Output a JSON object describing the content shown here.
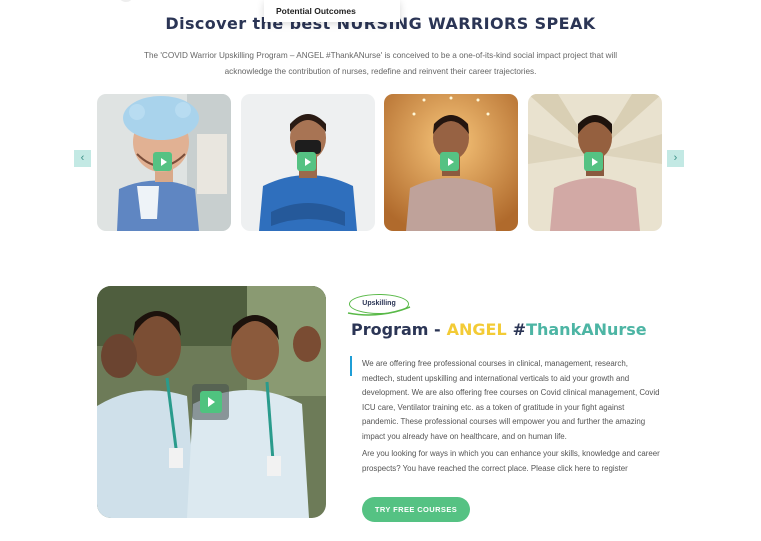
{
  "dropdown": {
    "label": "Potential Outcomes"
  },
  "section": {
    "heading": "Discover the best NURSING WARRIORS SPEAK",
    "intro": "The 'COVID Warrior Upskilling Program – ANGEL #ThankANurse' is conceived to be a one-of-its-kind social impact project that will acknowledge the contribution of nurses, redefine and reinvent their career trajectories."
  },
  "carousel": {
    "prev_icon": "chevron-left-icon",
    "next_icon": "chevron-right-icon",
    "prev_glyph": "‹",
    "next_glyph": "›",
    "play_icon": "play-icon"
  },
  "program": {
    "tag": "Upskilling",
    "title_prefix": "Program -",
    "title_angel": "ANGEL",
    "title_hash": "#",
    "title_tag": "ThankANurse",
    "paragraph1": "We are offering free professional courses in clinical, management, research, medtech, student upskilling and international verticals to aid your growth and development. We are also offering free courses on Covid clinical management, Covid ICU care, Ventilator training etc. as a token of gratitude in your fight against pandemic. These professional courses will empower you and further the amazing impact you already have on healthcare, and on human life.",
    "paragraph2": "Are you looking for ways in which you can enhance your skills, knowledge and career prospects? You have reached the correct place. Please click here to register",
    "cta": "TRY FREE COURSES"
  },
  "colors": {
    "heading": "#2b3555",
    "accent_green": "#55c283",
    "accent_yellow": "#f3cb36",
    "accent_teal": "#4db5a4",
    "arrow_bg": "#c3e9e4",
    "bar_blue": "#1f9ed6"
  }
}
